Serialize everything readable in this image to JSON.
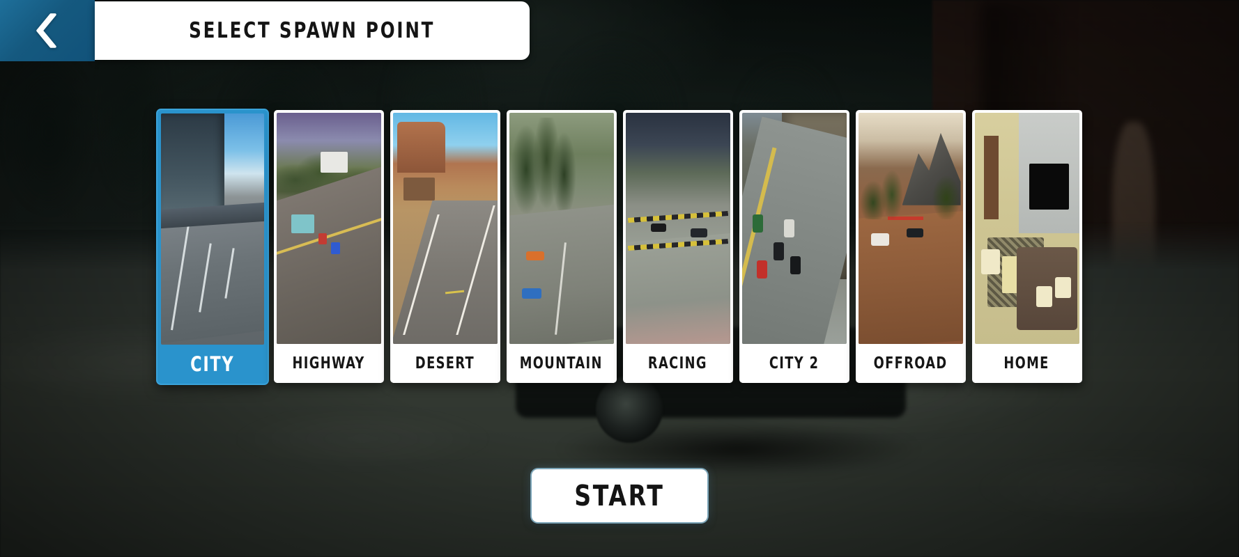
{
  "header": {
    "back_icon": "chevron-left-icon",
    "title": "SELECT SPAWN POINT",
    "back_color": "#15597f",
    "plate_color": "#ffffff"
  },
  "theme": {
    "accent": "#2a93cc",
    "card_bg": "#ffffff",
    "label_text": "#161616",
    "selected_label_text": "#ffffff"
  },
  "spawn_points": {
    "selected_index": 0,
    "items": [
      {
        "label": "CITY",
        "selected": true,
        "scene": "sc-city"
      },
      {
        "label": "HIGHWAY",
        "selected": false,
        "scene": "sc-hw"
      },
      {
        "label": "DESERT",
        "selected": false,
        "scene": "sc-des"
      },
      {
        "label": "MOUNTAIN",
        "selected": false,
        "scene": "sc-mtn"
      },
      {
        "label": "RACING",
        "selected": false,
        "scene": "sc-rac"
      },
      {
        "label": "CITY 2",
        "selected": false,
        "scene": "sc-c2"
      },
      {
        "label": "OFFROAD",
        "selected": false,
        "scene": "sc-off"
      },
      {
        "label": "HOME",
        "selected": false,
        "scene": "sc-home"
      }
    ]
  },
  "start": {
    "label": "START"
  }
}
